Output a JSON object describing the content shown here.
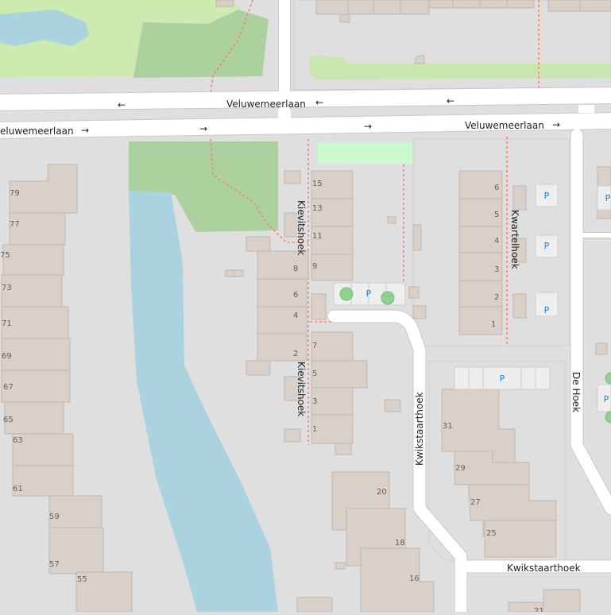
{
  "colors": {
    "background": "#e0dfdf",
    "building": "#d9d0c9",
    "building_stroke": "#c4b6ab",
    "water": "#aad3df",
    "park": "#c8facc",
    "grass": "#add19e",
    "road": "#ffffff",
    "road_casing": "#c9c7c7",
    "footpath": "#fa8072",
    "parking_fill": "#eeeeee",
    "parking_icon": "#1e7fd0",
    "tree": "#8fd18f",
    "label": "#222222",
    "housenumber": "#6b5f58"
  },
  "streets": {
    "veluwemeerlaan_top": "Veluwemeerlaan",
    "veluwemeerlaan_bottom_left": "eluwemeerlaan",
    "veluwemeerlaan_bottom_right": "Veluwemeerlaan",
    "kievitshoek_upper": "Kievitshoek",
    "kievitshoek_lower": "Kievitshoek",
    "kwartelhoek": "Kwartelhoek",
    "kwikstaarthoek_vertical": "Kwikstaarthoek",
    "kwikstaarthoek_horizontal": "Kwikstaarthoek",
    "de_hoek": "De Hoek"
  },
  "oneway": {
    "left": "←",
    "right": "→"
  },
  "parking_label": "P",
  "icons": {
    "parking": "parking-icon",
    "tree": "tree-icon",
    "oneway": "oneway-arrow-icon"
  },
  "house_numbers": {
    "west": [
      "79",
      "77",
      "75",
      "73",
      "71",
      "69",
      "67",
      "65",
      "63",
      "61",
      "59",
      "57",
      "55"
    ],
    "kievitshoek_west": [
      "8",
      "6",
      "4",
      "2"
    ],
    "kievitshoek_east": [
      "15",
      "13",
      "11",
      "9",
      "7",
      "5",
      "3",
      "1"
    ],
    "kwartelhoek_row": [
      "6",
      "5",
      "4",
      "3",
      "2",
      "1"
    ],
    "kwikstaarthoek_a": [
      "31",
      "29",
      "27",
      "25"
    ],
    "kwikstaarthoek_b": [
      "20",
      "18",
      "16"
    ],
    "partial_bottom": "21"
  }
}
